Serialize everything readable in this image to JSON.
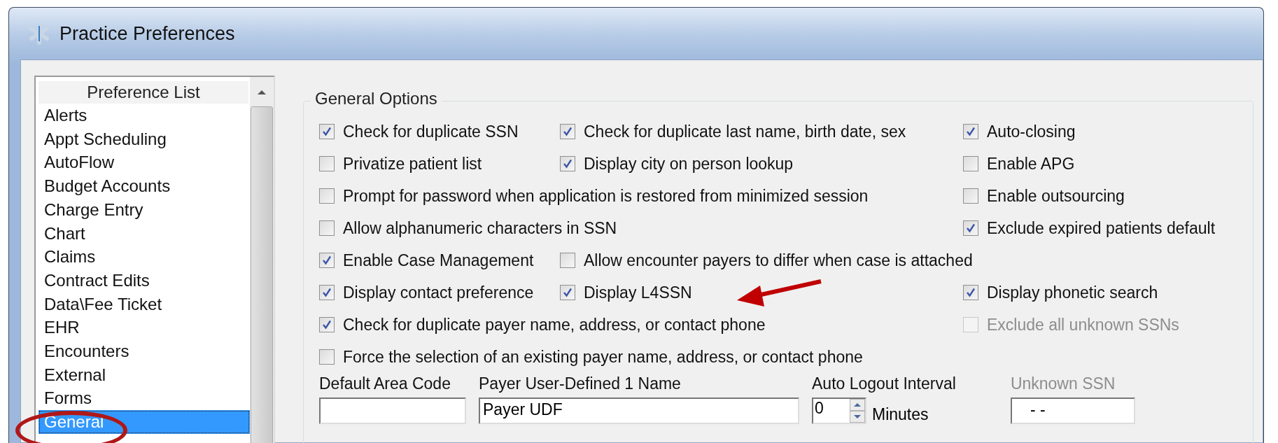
{
  "window": {
    "title": "Practice Preferences"
  },
  "preference_list": {
    "header": "Preference List",
    "items": [
      {
        "label": "Alerts",
        "selected": false
      },
      {
        "label": "Appt Scheduling",
        "selected": false
      },
      {
        "label": "AutoFlow",
        "selected": false
      },
      {
        "label": "Budget Accounts",
        "selected": false
      },
      {
        "label": "Charge Entry",
        "selected": false
      },
      {
        "label": "Chart",
        "selected": false
      },
      {
        "label": "Claims",
        "selected": false
      },
      {
        "label": "Contract Edits",
        "selected": false
      },
      {
        "label": "Data\\Fee Ticket",
        "selected": false
      },
      {
        "label": "EHR",
        "selected": false
      },
      {
        "label": "Encounters",
        "selected": false
      },
      {
        "label": "External",
        "selected": false
      },
      {
        "label": "Forms",
        "selected": false
      },
      {
        "label": "General",
        "selected": true
      }
    ]
  },
  "general_options": {
    "title": "General Options",
    "rows": [
      {
        "left": [
          {
            "label": "Check for duplicate SSN",
            "checked": true,
            "disabled": false
          },
          {
            "label": "Check for duplicate last name, birth date, sex",
            "checked": true,
            "disabled": false
          }
        ],
        "right": {
          "label": "Auto-closing",
          "checked": true,
          "disabled": false
        }
      },
      {
        "left": [
          {
            "label": "Privatize patient list",
            "checked": false,
            "disabled": false
          },
          {
            "label": "Display city on person lookup",
            "checked": true,
            "disabled": false
          }
        ],
        "right": {
          "label": "Enable APG",
          "checked": false,
          "disabled": false
        }
      },
      {
        "left": [
          {
            "label": "Prompt for password when application is restored from minimized session",
            "checked": false,
            "disabled": false
          }
        ],
        "right": {
          "label": "Enable outsourcing",
          "checked": false,
          "disabled": false
        }
      },
      {
        "left": [
          {
            "label": "Allow alphanumeric characters in SSN",
            "checked": false,
            "disabled": false
          }
        ],
        "right": {
          "label": "Exclude expired patients default",
          "checked": true,
          "disabled": false
        }
      },
      {
        "left": [
          {
            "label": "Enable Case Management",
            "checked": true,
            "disabled": false
          },
          {
            "label": "Allow encounter payers to differ when case is attached",
            "checked": false,
            "disabled": false
          }
        ]
      },
      {
        "left": [
          {
            "label": "Display contact preference",
            "checked": true,
            "disabled": false
          },
          {
            "label": "Display L4SSN",
            "checked": true,
            "disabled": false
          }
        ],
        "right": {
          "label": "Display phonetic search",
          "checked": true,
          "disabled": false
        }
      },
      {
        "left": [
          {
            "label": "Check for duplicate payer name, address, or contact phone",
            "checked": true,
            "disabled": false
          }
        ],
        "right": {
          "label": "Exclude all unknown SSNs",
          "checked": false,
          "disabled": true
        }
      },
      {
        "left": [
          {
            "label": "Force the selection of an existing payer name, address, or contact phone",
            "checked": false,
            "disabled": false
          }
        ]
      }
    ]
  },
  "fields": [
    {
      "kind": "text",
      "label": "Default Area Code",
      "disabled": false
    },
    {
      "kind": "wide",
      "label": "Payer User-Defined 1 Name",
      "value": "Payer UDF",
      "disabled": false
    },
    {
      "kind": "spin",
      "label": "Auto Logout Interval",
      "value": "0",
      "unit": "Minutes",
      "disabled": false
    },
    {
      "kind": "text",
      "label": "Unknown SSN",
      "value": "- -",
      "disabled": true
    }
  ]
}
